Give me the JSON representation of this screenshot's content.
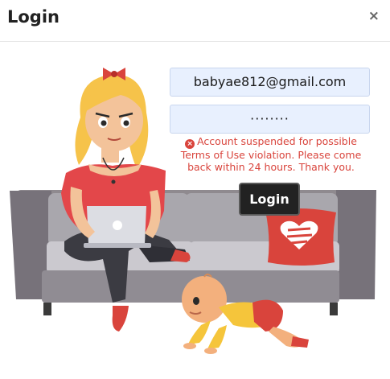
{
  "modal": {
    "title": "Login",
    "close_icon": "×"
  },
  "form": {
    "email_value": "babyae812@gmail.com",
    "password_value": "········",
    "error_icon": "×",
    "error_message": "Account suspended for possible Terms of Use violation. Please come back within 24 hours. Thank you.",
    "login_label": "Login"
  },
  "colors": {
    "error": "#d9443c",
    "button": "#222222",
    "field_bg": "#e8f0fe"
  }
}
